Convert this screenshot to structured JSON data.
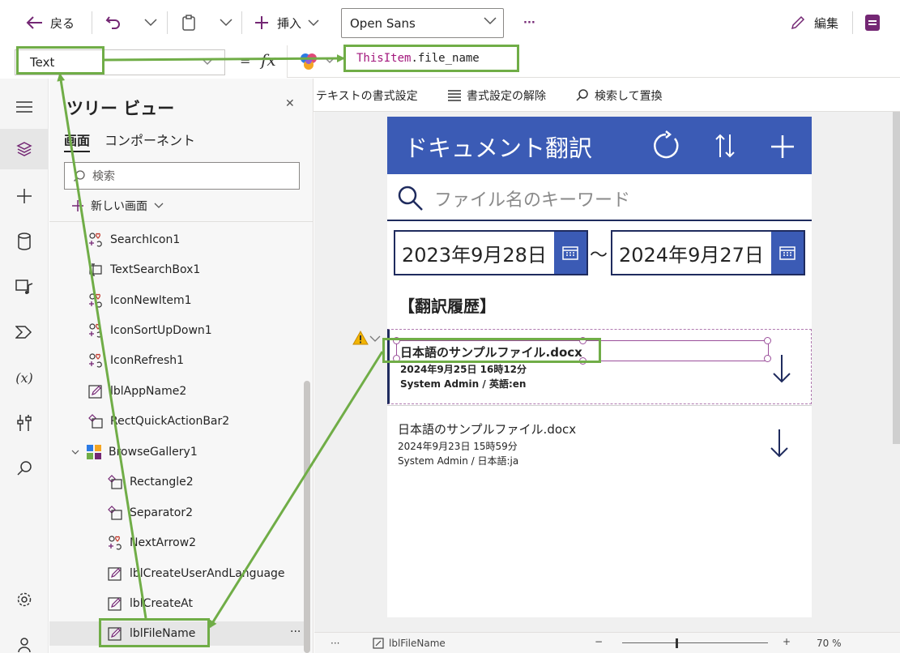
{
  "toolbar": {
    "back_label": "戻る",
    "insert_label": "挿入",
    "font_name": "Open Sans",
    "more_label": "···",
    "edit_label": "編集"
  },
  "formula_bar": {
    "property": "Text",
    "fx": "fx",
    "formula_keyword": "ThisItem",
    "formula_rest": ".file_name"
  },
  "format_bar": {
    "text_format": "テキストの書式設定",
    "clear_format": "書式設定の解除",
    "find_replace": "検索して置換"
  },
  "tree": {
    "title": "ツリー ビュー",
    "tab_screens": "画面",
    "tab_components": "コンポーネント",
    "search_placeholder": "検索",
    "new_screen": "新しい画面",
    "items": [
      {
        "label": "SearchIcon1",
        "icon": "icon-control"
      },
      {
        "label": "TextSearchBox1",
        "icon": "textinput"
      },
      {
        "label": "IconNewItem1",
        "icon": "icon-control"
      },
      {
        "label": "IconSortUpDown1",
        "icon": "icon-control"
      },
      {
        "label": "IconRefresh1",
        "icon": "icon-control"
      },
      {
        "label": "lblAppName2",
        "icon": "label"
      },
      {
        "label": "RectQuickActionBar2",
        "icon": "shape"
      },
      {
        "label": "BrowseGallery1",
        "icon": "gallery"
      },
      {
        "label": "Rectangle2",
        "icon": "shape"
      },
      {
        "label": "Separator2",
        "icon": "shape"
      },
      {
        "label": "NextArrow2",
        "icon": "icon-control"
      },
      {
        "label": "lblCreateUserAndLanguage",
        "icon": "label"
      },
      {
        "label": "lblCreateAt",
        "icon": "label"
      },
      {
        "label": "lblFileName",
        "icon": "label"
      }
    ],
    "selected_more": "···"
  },
  "app": {
    "title": "ドキュメント翻訳",
    "search_placeholder": "ファイル名のキーワード",
    "date_from": "2023年9月28日",
    "date_to": "2024年9月27日",
    "tilde": "～",
    "section_title": "【翻訳履歴】",
    "gallery": [
      {
        "file_name": "日本語のサンプルファイル.docx",
        "created_at": "2024年9月25日 16時12分",
        "user_lang": "System Admin / 英語:en"
      },
      {
        "file_name": "日本語のサンプルファイル.docx",
        "created_at": "2024年9月23日 15時59分",
        "user_lang": "System Admin / 日本語:ja"
      }
    ]
  },
  "statusbar": {
    "dots": "···",
    "control_name": "lblFileName",
    "zoom": "70 %"
  },
  "colors": {
    "accent": "#742774",
    "app_header": "#3b5bb5",
    "annotation": "#70ad47"
  }
}
